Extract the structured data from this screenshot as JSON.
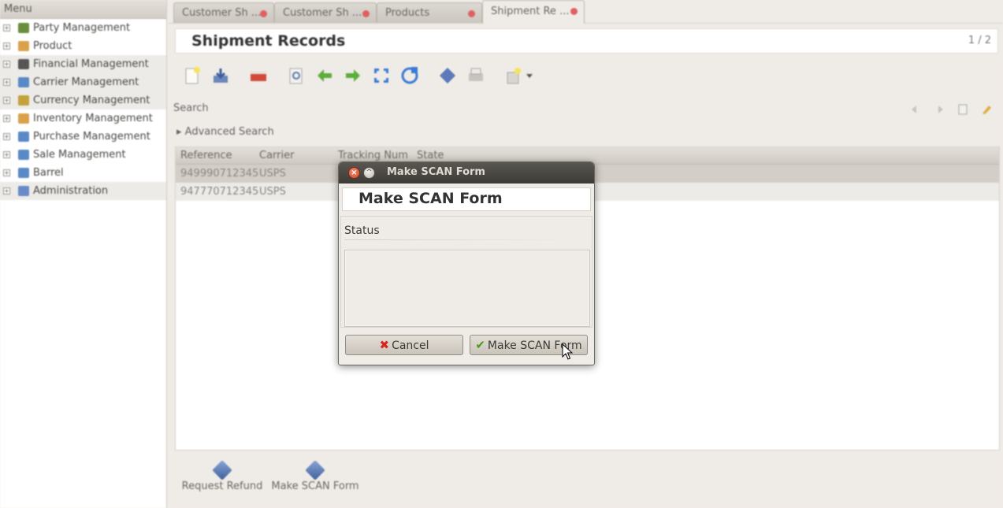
{
  "sidebar": {
    "header": "Menu",
    "items": [
      {
        "label": "Party Management",
        "color": "#6a8e3c"
      },
      {
        "label": "Product",
        "color": "#d9a24a"
      },
      {
        "label": "Financial Management",
        "color": "#555555"
      },
      {
        "label": "Carrier Management",
        "color": "#5a8ac6"
      },
      {
        "label": "Currency Management",
        "color": "#c2a23a"
      },
      {
        "label": "Inventory Management",
        "color": "#d9a24a"
      },
      {
        "label": "Purchase Management",
        "color": "#5a8ac6"
      },
      {
        "label": "Sale Management",
        "color": "#5a8ac6"
      },
      {
        "label": "Barrel",
        "color": "#5a8ac6"
      },
      {
        "label": "Administration",
        "color": "#6a8ac6"
      }
    ]
  },
  "tabs": [
    {
      "label": "Customer Sh ..."
    },
    {
      "label": "Customer Sh ..."
    },
    {
      "label": "Products"
    },
    {
      "label": "Shipment Re ..."
    }
  ],
  "main": {
    "title": "Shipment Records",
    "page_count": "1 / 2",
    "search_label": "Search",
    "advanced_search": "Advanced Search",
    "columns": [
      "Reference",
      "Carrier",
      "Tracking Num",
      "State"
    ],
    "rows": [
      {
        "reference": "949990712345",
        "carrier": "USPS"
      },
      {
        "reference": "947770712345",
        "carrier": "USPS"
      }
    ],
    "actions": [
      {
        "label": "Request Refund"
      },
      {
        "label": "Make SCAN Form"
      }
    ]
  },
  "dialog": {
    "window_title": "Make SCAN Form",
    "heading": "Make SCAN Form",
    "status_label": "Status",
    "cancel_label": "Cancel",
    "ok_label": "Make SCAN Form"
  }
}
